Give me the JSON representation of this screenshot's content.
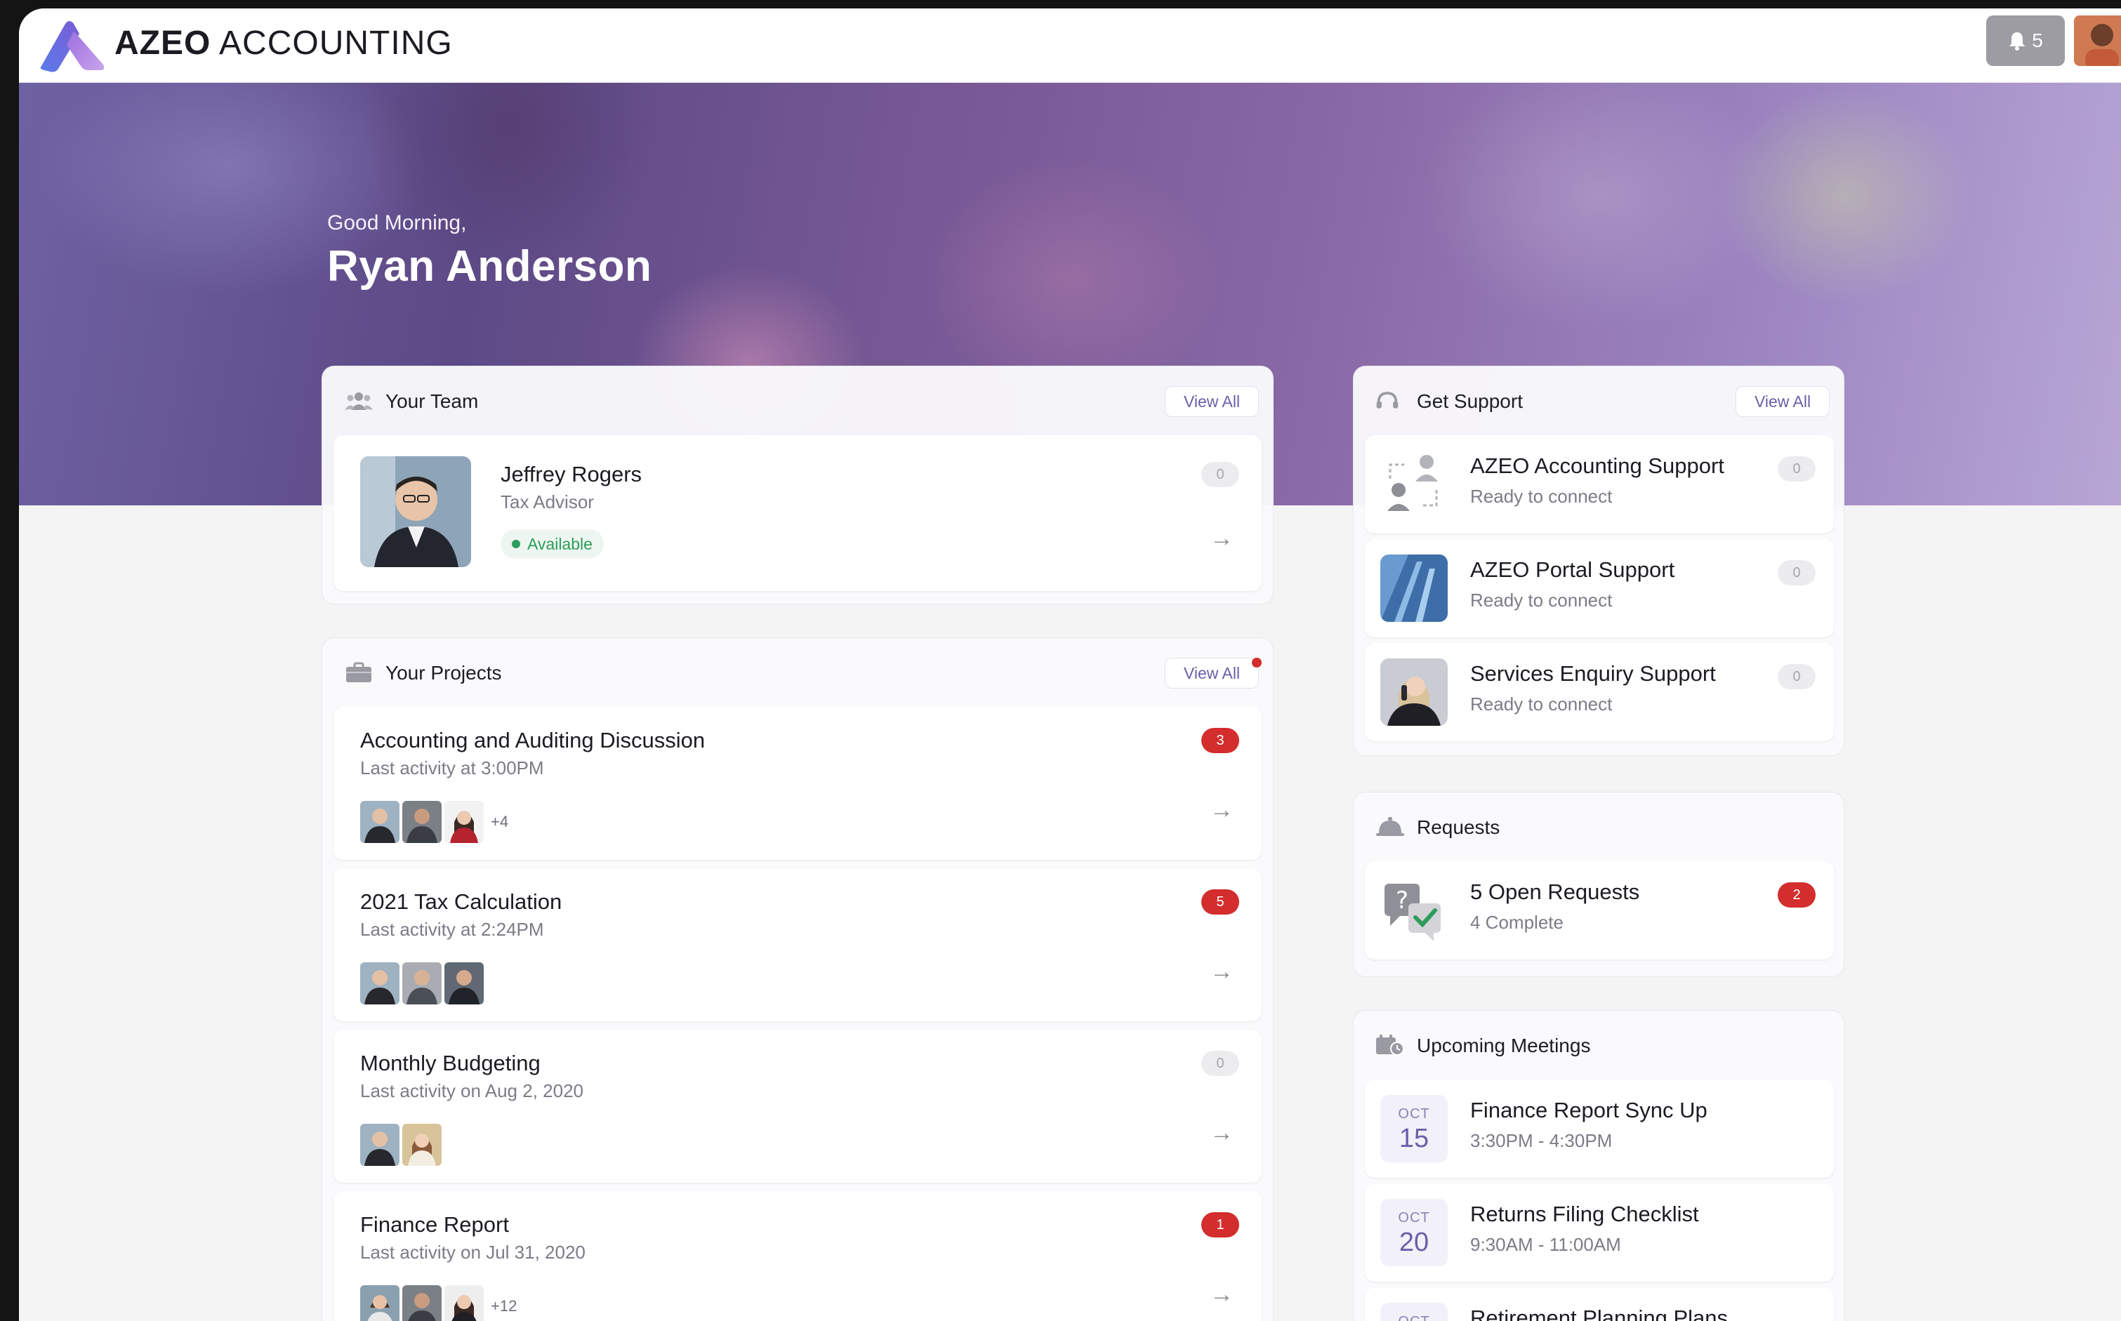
{
  "brand": {
    "bold": "AZEO",
    "light": "ACCOUNTING"
  },
  "header": {
    "notifications": "5"
  },
  "hero": {
    "greeting": "Good Morning,",
    "name": "Ryan Anderson"
  },
  "team": {
    "title": "Your Team",
    "view_all": "View All",
    "member": {
      "name": "Jeffrey Rogers",
      "role": "Tax Advisor",
      "status": "Available",
      "badge": "0"
    }
  },
  "projects": {
    "title": "Your Projects",
    "view_all": "View All",
    "items": [
      {
        "title": "Accounting and Auditing Discussion",
        "activity": "Last activity at 3:00PM",
        "badge": "3",
        "more": "+4"
      },
      {
        "title": "2021 Tax Calculation",
        "activity": "Last activity at 2:24PM",
        "badge": "5",
        "more": ""
      },
      {
        "title": "Monthly Budgeting",
        "activity": "Last activity on Aug 2, 2020",
        "badge": "0",
        "more": ""
      },
      {
        "title": "Finance Report",
        "activity": "Last activity on Jul 31, 2020",
        "badge": "1",
        "more": "+12"
      }
    ]
  },
  "support": {
    "title": "Get Support",
    "view_all": "View All",
    "items": [
      {
        "title": "AZEO Accounting Support",
        "status": "Ready to connect",
        "badge": "0"
      },
      {
        "title": "AZEO Portal Support",
        "status": "Ready to connect",
        "badge": "0"
      },
      {
        "title": "Services Enquiry Support",
        "status": "Ready to connect",
        "badge": "0"
      }
    ]
  },
  "requests": {
    "title": "Requests",
    "item": {
      "title": "5 Open Requests",
      "sub": "4 Complete",
      "badge": "2"
    }
  },
  "meetings": {
    "title": "Upcoming Meetings",
    "items": [
      {
        "month": "OCT",
        "day": "15",
        "title": "Finance Report Sync Up",
        "time": "3:30PM - 4:30PM"
      },
      {
        "month": "OCT",
        "day": "20",
        "title": "Returns Filing Checklist",
        "time": "9:30AM - 11:00AM"
      },
      {
        "month": "OCT",
        "day": "",
        "title": "Retirement Planning Plans",
        "time": ""
      }
    ]
  },
  "colors": {
    "accent": "#6b5fa8",
    "badge": "#d32d2d",
    "available": "#2e9c5a"
  }
}
